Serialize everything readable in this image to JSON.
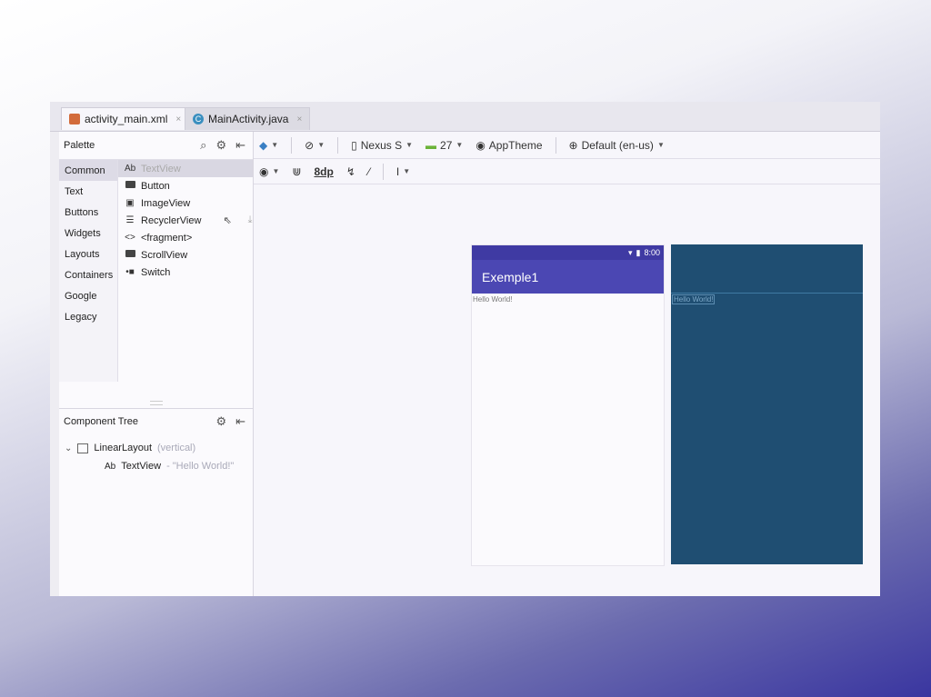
{
  "tabs": [
    {
      "label": "activity_main.xml",
      "close": "×",
      "icon": "xml-layout-icon"
    },
    {
      "label": "MainActivity.java",
      "close": "×",
      "icon": "java-class-icon"
    }
  ],
  "palette": {
    "title": "Palette",
    "categories": [
      "Common",
      "Text",
      "Buttons",
      "Widgets",
      "Layouts",
      "Containers",
      "Google",
      "Legacy"
    ],
    "items": [
      {
        "glyph": "Ab",
        "label": "TextView"
      },
      {
        "glyph": "",
        "label": "Button"
      },
      {
        "glyph": "▣",
        "label": "ImageView"
      },
      {
        "glyph": "☰",
        "label": "RecyclerView"
      },
      {
        "glyph": "<>",
        "label": "<fragment>"
      },
      {
        "glyph": "",
        "label": "ScrollView"
      },
      {
        "glyph": "•■",
        "label": "Switch"
      }
    ]
  },
  "component_tree": {
    "title": "Component Tree",
    "root": {
      "label": "LinearLayout",
      "sub": "(vertical)"
    },
    "child": {
      "glyph": "Ab",
      "label": "TextView",
      "sub": "- \"Hello World!\""
    }
  },
  "toolbar": {
    "device": "Nexus S",
    "api": "27",
    "theme": "AppTheme",
    "locale": "Default (en-us)",
    "margin": "8dp"
  },
  "preview": {
    "time": "8:00",
    "app_title": "Exemple1",
    "hello_text": "Hello World!"
  },
  "colors": {
    "app_bar": "#4b47b3",
    "status_bar": "#3f3aa3",
    "blueprint": "#1f4e72"
  }
}
